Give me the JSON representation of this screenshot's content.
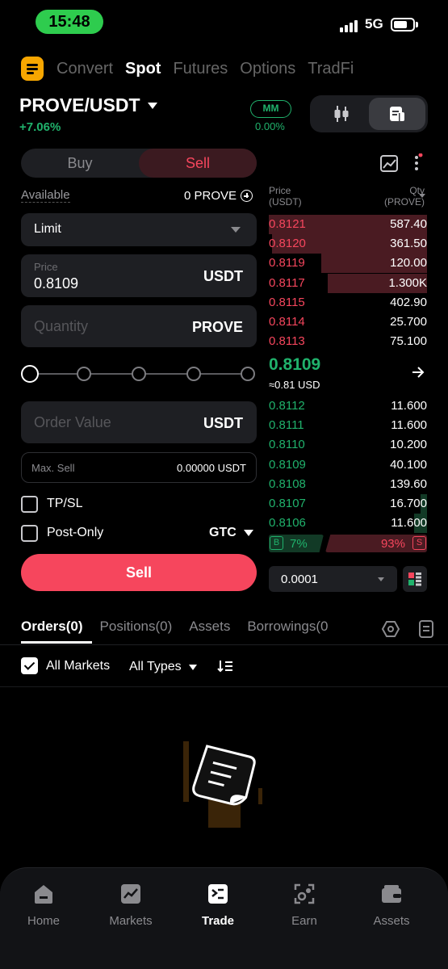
{
  "status_bar": {
    "time": "15:48",
    "network": "5G"
  },
  "top_tabs": [
    {
      "label": "Convert",
      "active": false
    },
    {
      "label": "Spot",
      "active": true
    },
    {
      "label": "Futures",
      "active": false
    },
    {
      "label": "Options",
      "active": false
    },
    {
      "label": "TradFi",
      "active": false
    }
  ],
  "pair": {
    "symbol": "PROVE/USDT",
    "change": "+7.06%",
    "mm_label": "MM",
    "mm_value": "0.00%"
  },
  "order_form": {
    "side_buy": "Buy",
    "side_sell": "Sell",
    "available_label": "Available",
    "available_value": "0 PROVE",
    "order_type": "Limit",
    "price_label": "Price",
    "price_value": "0.8109",
    "price_unit": "USDT",
    "quantity_placeholder": "Quantity",
    "quantity_unit": "PROVE",
    "order_value_placeholder": "Order Value",
    "order_value_unit": "USDT",
    "max_sell_label": "Max. Sell",
    "max_sell_value": "0.00000 USDT",
    "tpsl_label": "TP/SL",
    "post_only_label": "Post-Only",
    "time_in_force": "GTC",
    "submit_label": "Sell",
    "slider_percent": 0
  },
  "order_book": {
    "price_header": [
      "Price",
      "(USDT)"
    ],
    "qty_header": [
      "Qty",
      "(PROVE)"
    ],
    "asks": [
      {
        "price": "0.8121",
        "qty": "587.40",
        "depth": 1.0
      },
      {
        "price": "0.8120",
        "qty": "361.50",
        "depth": 0.98
      },
      {
        "price": "0.8119",
        "qty": "120.00",
        "depth": 0.67
      },
      {
        "price": "0.8117",
        "qty": "1.300K",
        "depth": 0.63
      },
      {
        "price": "0.8115",
        "qty": "402.90",
        "depth": 0.0
      },
      {
        "price": "0.8114",
        "qty": "25.700",
        "depth": 0.0
      },
      {
        "price": "0.8113",
        "qty": "75.100",
        "depth": 0.0
      }
    ],
    "mid_price": "0.8109",
    "mid_usd": "≈0.81 USD",
    "bids": [
      {
        "price": "0.8112",
        "qty": "11.600",
        "depth": 0.0
      },
      {
        "price": "0.8111",
        "qty": "11.600",
        "depth": 0.0
      },
      {
        "price": "0.8110",
        "qty": "10.200",
        "depth": 0.0
      },
      {
        "price": "0.8109",
        "qty": "40.100",
        "depth": 0.0
      },
      {
        "price": "0.8108",
        "qty": "139.60",
        "depth": 0.0
      },
      {
        "price": "0.8107",
        "qty": "16.700",
        "depth": 0.04
      },
      {
        "price": "0.8106",
        "qty": "11.600",
        "depth": 0.08
      }
    ],
    "buy_ratio_box": "B",
    "buy_ratio": "7%",
    "sell_ratio": "93%",
    "sell_ratio_box": "S",
    "precision": "0.0001"
  },
  "orders_tabs": [
    {
      "label": "Orders(0)",
      "active": true
    },
    {
      "label": "Positions(0)",
      "active": false
    },
    {
      "label": "Assets",
      "active": false
    },
    {
      "label": "Borrowings(0",
      "active": false
    }
  ],
  "filters": {
    "all_markets": "All Markets",
    "all_types": "All Types"
  },
  "bottom_nav": [
    {
      "label": "Home",
      "icon": "home-icon",
      "active": false
    },
    {
      "label": "Markets",
      "icon": "markets-icon",
      "active": false
    },
    {
      "label": "Trade",
      "icon": "trade-icon",
      "active": true
    },
    {
      "label": "Earn",
      "icon": "earn-icon",
      "active": false
    },
    {
      "label": "Assets",
      "icon": "wallet-icon",
      "active": false
    }
  ],
  "colors": {
    "accent": "#f7a600",
    "buy": "#20b26c",
    "sell": "#f6465d",
    "background": "#000000"
  }
}
